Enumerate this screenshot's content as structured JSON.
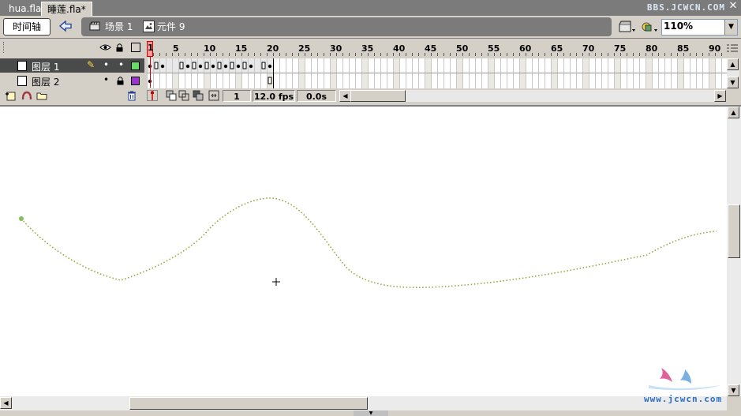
{
  "doc_tabs": [
    {
      "label": "hua.fla",
      "active": false
    },
    {
      "label": "睡莲.fla*",
      "active": true
    }
  ],
  "watermark_top": "BBS.JCWCN.COM",
  "editbar": {
    "timeline_button": "时间轴",
    "scene_label": "场景 1",
    "symbol_label": "元件 9",
    "zoom": "110%"
  },
  "timeline": {
    "ruler_labels": [
      "1",
      "5",
      "10",
      "15",
      "20",
      "25",
      "30",
      "35",
      "40",
      "45",
      "50",
      "55",
      "60",
      "65",
      "70",
      "75",
      "80",
      "85",
      "90"
    ],
    "current_frame_marker": "1",
    "layers": [
      {
        "name": "图层 1",
        "selected": true,
        "color": "#66dd66"
      },
      {
        "name": "图层 2",
        "selected": false,
        "color": "#9933cc"
      }
    ],
    "status": {
      "frame": "1",
      "fps": "12.0 fps",
      "time": "0.0s"
    }
  },
  "watermark_bottom": "www.jcwcn.com",
  "colors": {
    "path_stroke": "#8faa3a",
    "selected_layer_bg": "#4a4a4a",
    "chrome": "#d4d0c8"
  }
}
